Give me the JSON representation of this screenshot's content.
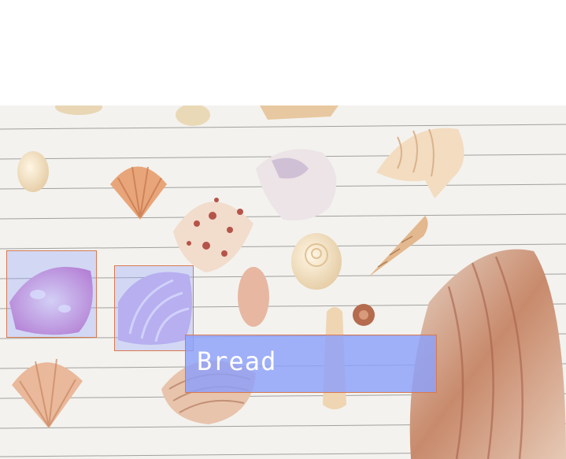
{
  "scene": {
    "description_icon": "seashells-on-lined-paper-photo"
  },
  "annotation": {
    "label": "Bread",
    "box_color": "#d9794e",
    "fill_color": "#8ca0fa"
  }
}
